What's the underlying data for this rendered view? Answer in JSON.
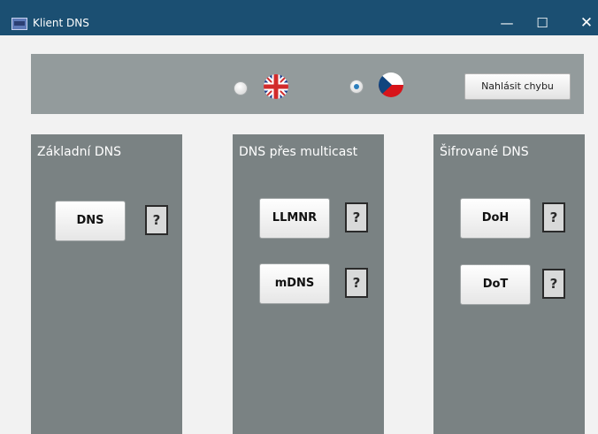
{
  "window": {
    "title": "Klient DNS",
    "controls": {
      "minimize": "—",
      "maximize": "☐",
      "close": "✕"
    }
  },
  "top_panel": {
    "language_options": [
      {
        "flag": "uk-flag-icon",
        "selected": false
      },
      {
        "flag": "czech-flag-icon",
        "selected": true
      }
    ],
    "report_button": "Nahlásit chybu"
  },
  "columns": [
    {
      "title": "Základní DNS",
      "buttons": [
        {
          "label": "DNS",
          "help": "?"
        }
      ]
    },
    {
      "title": "DNS přes multicast",
      "buttons": [
        {
          "label": "LLMNR",
          "help": "?"
        },
        {
          "label": "mDNS",
          "help": "?"
        }
      ]
    },
    {
      "title": "Šifrované DNS",
      "buttons": [
        {
          "label": "DoH",
          "help": "?"
        },
        {
          "label": "DoT",
          "help": "?"
        }
      ]
    }
  ],
  "colors": {
    "titlebar": "#1b4f72",
    "panel": "#939b9c",
    "column": "#7a8283",
    "radio_selected": "#2d7fbd"
  }
}
